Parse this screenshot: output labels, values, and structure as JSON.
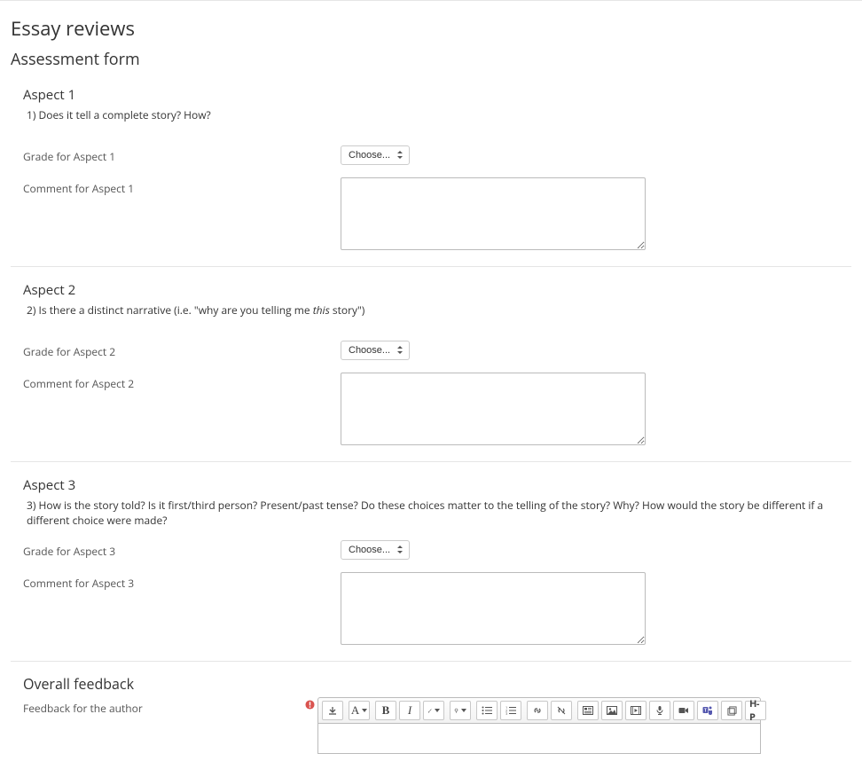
{
  "page": {
    "title": "Essay reviews",
    "form_title": "Assessment form"
  },
  "aspects": [
    {
      "heading": "Aspect 1",
      "desc_prefix": "1) Does it tell a complete story? How?",
      "desc_italic": "",
      "desc_suffix": "",
      "grade_label": "Grade for Aspect 1",
      "comment_label": "Comment for Aspect 1",
      "select_placeholder": "Choose..."
    },
    {
      "heading": "Aspect 2",
      "desc_prefix": "2) Is there a distinct narrative (i.e. \"why are you telling me ",
      "desc_italic": "this",
      "desc_suffix": " story\")",
      "grade_label": "Grade for Aspect 2",
      "comment_label": "Comment for Aspect 2",
      "select_placeholder": "Choose..."
    },
    {
      "heading": "Aspect 3",
      "desc_prefix": "3) How is the story told? Is it first/third person? Present/past tense? Do these choices matter to the telling of the story? Why? How would the story be different if a different choice were made?",
      "desc_italic": "",
      "desc_suffix": "",
      "grade_label": "Grade for Aspect 3",
      "comment_label": "Comment for Aspect 3",
      "select_placeholder": "Choose..."
    }
  ],
  "overall": {
    "heading": "Overall feedback",
    "label": "Feedback for the author"
  },
  "toolbar": {
    "collapse": "↓",
    "styles": "A",
    "bold": "B",
    "italic": "I",
    "h5p": "H-P"
  }
}
